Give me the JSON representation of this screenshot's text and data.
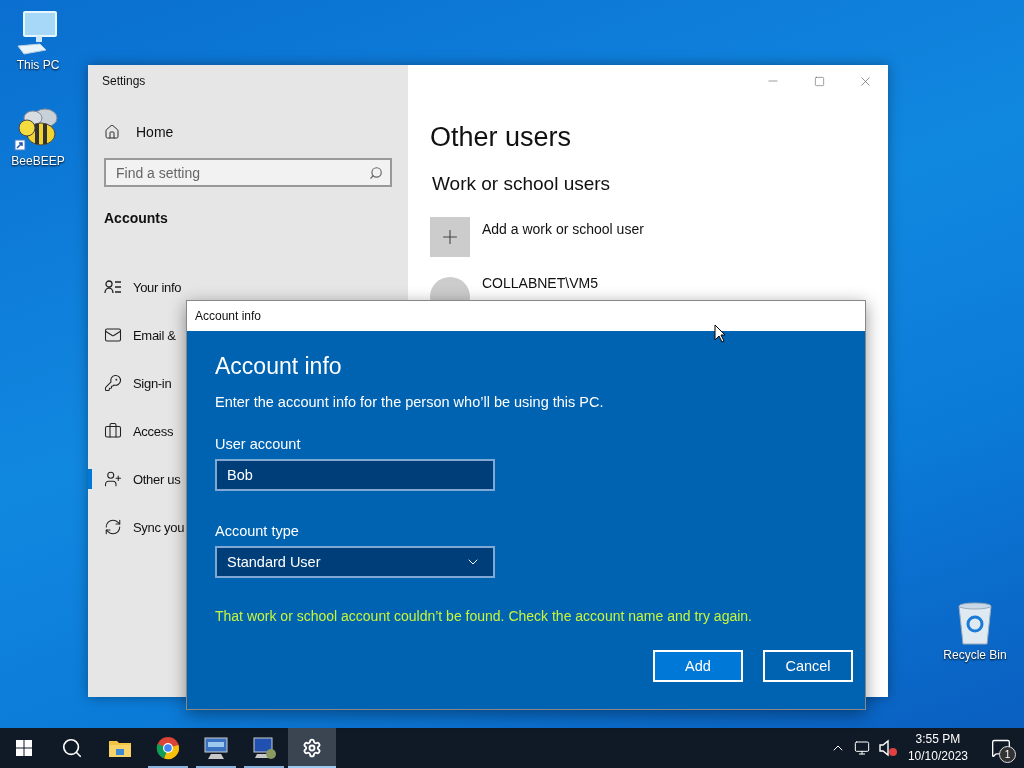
{
  "desktop_icons": [
    {
      "label": "This PC",
      "kind": "computer"
    },
    {
      "label": "BeeBEEP",
      "kind": "bee"
    },
    {
      "label": "Recycle Bin",
      "kind": "bin"
    }
  ],
  "settings_window": {
    "title": "Settings",
    "sidebar": {
      "home": "Home",
      "search": {
        "placeholder": "Find a setting"
      },
      "section": "Accounts",
      "items": [
        {
          "label": "Your info",
          "selected": false
        },
        {
          "label": "Email &",
          "selected": false
        },
        {
          "label": "Sign-in",
          "selected": false
        },
        {
          "label": "Access",
          "selected": false
        },
        {
          "label": "Other us",
          "selected": true
        },
        {
          "label": "Sync you",
          "selected": false
        }
      ]
    },
    "heading": "Other users",
    "subheading": "Work or school users",
    "add_user": "Add a work or school user",
    "user_entry": "COLLABNET\\VM5"
  },
  "dialog": {
    "title": "Account info",
    "heading": "Account info",
    "description": "Enter the account info for the person who’ll be using this PC.",
    "user_account": {
      "label": "User account",
      "value": "Bob"
    },
    "account_type": {
      "label": "Account type",
      "value": "Standard User"
    },
    "error_message": "That work or school account couldn’t be found. Check the account name and try again.",
    "buttons": [
      {
        "label": "Add",
        "kind": "primary"
      },
      {
        "label": "Cancel",
        "kind": "secondary"
      }
    ]
  },
  "taskbar": {
    "apps": [
      {
        "kind": "start",
        "running": false,
        "selected": false
      },
      {
        "kind": "search",
        "running": false,
        "selected": false
      },
      {
        "kind": "folder",
        "running": false,
        "selected": false
      },
      {
        "kind": "browser",
        "running": true,
        "selected": false
      },
      {
        "kind": "remote",
        "running": true,
        "selected": false
      },
      {
        "kind": "network_pc",
        "running": true,
        "selected": false
      },
      {
        "kind": "settings",
        "running": true,
        "selected": true
      }
    ],
    "time": "3:55 PM",
    "date": "10/10/2023",
    "notifications": "1"
  }
}
